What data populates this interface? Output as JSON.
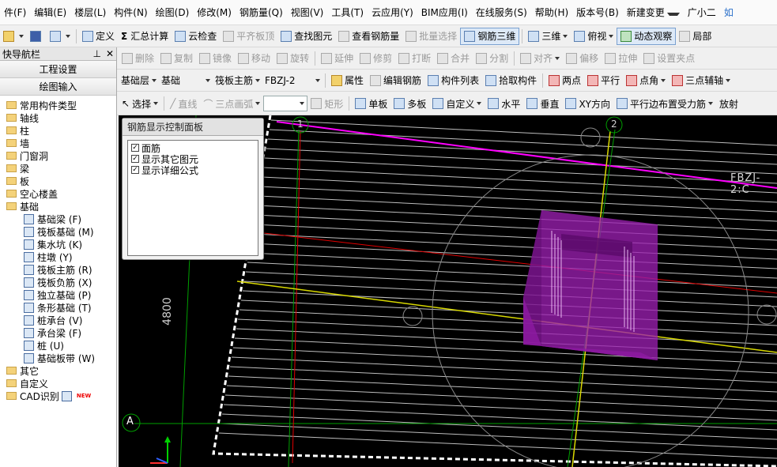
{
  "menu": [
    "件(F)",
    "编辑(E)",
    "楼层(L)",
    "构件(N)",
    "绘图(D)",
    "修改(M)",
    "钢筋量(Q)",
    "视图(V)",
    "工具(T)",
    "云应用(Y)",
    "BIM应用(I)",
    "在线服务(S)",
    "帮助(H)",
    "版本号(B)",
    "新建变更",
    "广小二",
    "如"
  ],
  "toolbar1": {
    "define": "定义",
    "sum_calc": "汇总计算",
    "cloud_check": "云检查",
    "level_top": "平齐板顶",
    "find_element": "查找图元",
    "view_rebar_qty": "查看钢筋量",
    "batch_select": "批量选择",
    "rebar_3d": "钢筋三维",
    "view_3d": "三维",
    "top_view": "俯视",
    "dynamic_observe": "动态观察",
    "local": "局部"
  },
  "toolbar2": {
    "nav_title": "快导航栏",
    "delete": "删除",
    "copy": "复制",
    "mirror": "镜像",
    "move": "移动",
    "rotate": "旋转",
    "extend": "延伸",
    "trim": "修剪",
    "break": "打断",
    "merge": "合并",
    "split": "分割",
    "align": "对齐",
    "offset": "偏移",
    "stretch": "拉伸",
    "set_clamp": "设置夹点"
  },
  "toolbar3": {
    "floor": "基础层",
    "category": "基础",
    "type": "筏板主筋",
    "name": "FBZJ-2",
    "attributes": "属性",
    "edit_rebar": "编辑钢筋",
    "component_list": "构件列表",
    "pick_component": "拾取构件",
    "two_points": "两点",
    "parallel": "平行",
    "point_angle": "点角",
    "three_point_aux": "三点辅轴"
  },
  "toolbar4": {
    "select": "选择",
    "line": "直线",
    "three_point_arc": "三点画弧",
    "rect": "矩形",
    "single_board": "单板",
    "multi_board": "多板",
    "custom": "自定义",
    "horizontal": "水平",
    "vertical": "垂直",
    "xy_direction": "XY方向",
    "parallel_edge": "平行边布置受力筋",
    "radial": "放射"
  },
  "sidebar": {
    "eng_settings": "工程设置",
    "drawing_input": "绘图输入",
    "tree": [
      {
        "label": "常用构件类型",
        "kind": "folder"
      },
      {
        "label": "轴线",
        "kind": "folder"
      },
      {
        "label": "柱",
        "kind": "folder"
      },
      {
        "label": "墙",
        "kind": "folder"
      },
      {
        "label": "门窗洞",
        "kind": "folder"
      },
      {
        "label": "梁",
        "kind": "folder"
      },
      {
        "label": "板",
        "kind": "folder"
      },
      {
        "label": "空心楼盖",
        "kind": "folder"
      },
      {
        "label": "基础",
        "kind": "folder-open"
      },
      {
        "label": "基础梁 (F)",
        "kind": "item"
      },
      {
        "label": "筏板基础 (M)",
        "kind": "item"
      },
      {
        "label": "集水坑 (K)",
        "kind": "item"
      },
      {
        "label": "柱墩 (Y)",
        "kind": "item"
      },
      {
        "label": "筏板主筋 (R)",
        "kind": "item"
      },
      {
        "label": "筏板负筋 (X)",
        "kind": "item"
      },
      {
        "label": "独立基础 (P)",
        "kind": "item"
      },
      {
        "label": "条形基础 (T)",
        "kind": "item"
      },
      {
        "label": "桩承台 (V)",
        "kind": "item"
      },
      {
        "label": "承台梁 (F)",
        "kind": "item"
      },
      {
        "label": "桩 (U)",
        "kind": "item"
      },
      {
        "label": "基础板带 (W)",
        "kind": "item"
      },
      {
        "label": "其它",
        "kind": "folder"
      },
      {
        "label": "自定义",
        "kind": "folder"
      },
      {
        "label": "CAD识别",
        "kind": "folder"
      }
    ],
    "new_badge": "NEW"
  },
  "panel": {
    "title": "钢筋显示控制面板",
    "options": [
      "面筋",
      "显示其它图元",
      "显示详细公式"
    ]
  },
  "canvas": {
    "axis_1": "1",
    "axis_2": "2",
    "axis_a": "A",
    "dimension": "4800",
    "rebar_label": "FBZJ-2:C",
    "colors": {
      "background": "#000000",
      "magenta": "#ff00ff",
      "pier": "#9a1fb0",
      "red": "#e00000",
      "yellow": "#d8d800",
      "green": "#00b000"
    }
  }
}
